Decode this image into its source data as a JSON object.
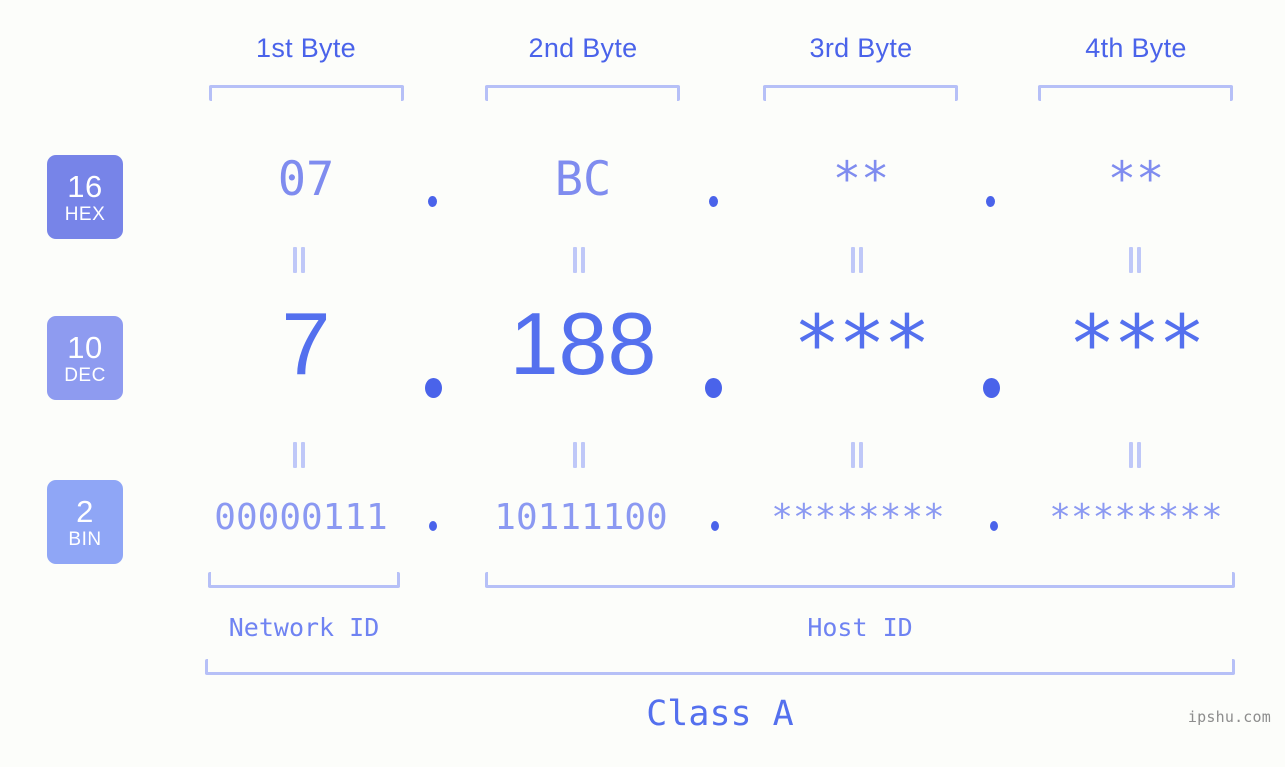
{
  "background_color": "#fcfdfa",
  "accent_color": "#4a63ea",
  "headers": [
    {
      "label": "1st Byte"
    },
    {
      "label": "2nd Byte"
    },
    {
      "label": "3rd Byte"
    },
    {
      "label": "4th Byte"
    }
  ],
  "rows": [
    {
      "badge": {
        "base": "16",
        "name": "HEX",
        "color": "#7784e8"
      },
      "values": [
        "07",
        "BC",
        "**",
        "**"
      ]
    },
    {
      "badge": {
        "base": "10",
        "name": "DEC",
        "color": "#8e9bf0"
      },
      "values": [
        "7",
        "188",
        "***",
        "***"
      ]
    },
    {
      "badge": {
        "base": "2",
        "name": "BIN",
        "color": "#8fa6f6"
      },
      "values": [
        "00000111",
        "10111100",
        "********",
        "********"
      ]
    }
  ],
  "separator": ".",
  "equivalence_mark": "=",
  "segments": {
    "network_id": "Network ID",
    "host_id": "Host ID",
    "class": "Class A"
  },
  "watermark": "ipshu.com"
}
